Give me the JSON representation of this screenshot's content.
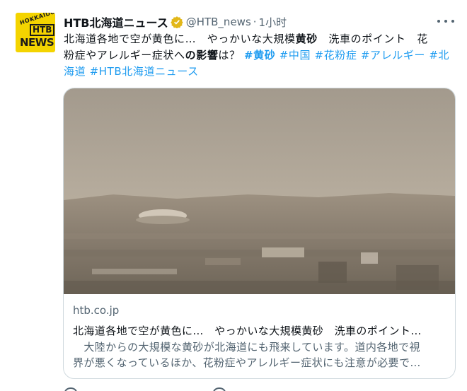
{
  "account": {
    "display_name": "HTB北海道ニュース",
    "handle": "@HTB_news",
    "separator": "·",
    "time": "1小时",
    "avatar": {
      "arc_text": "HOKKAIDO",
      "box_text": "HTB",
      "bottom_text": "NEWS",
      "bg_color": "#f4d400"
    }
  },
  "tweet": {
    "line1": "北海道各地で空が黄色に…　やっかいな大規模",
    "line1_bold": "黄砂",
    "line1_end": "　洗車のポイント　花",
    "line2_a": "粉症やアレルギー症状へ",
    "line2_bold_no": "の",
    "line2_bold": "影響",
    "line2_b": "は？ ",
    "hashtags": [
      "#黄砂",
      "#中国",
      "#花粉症",
      "#アレルギー",
      "#北",
      "海道",
      "#HTB北海道ニュース"
    ]
  },
  "card": {
    "domain": "htb.co.jp",
    "title": "北海道各地で空が黄色に…　やっかいな大規模黄砂　洗車のポイント…",
    "desc_line1": "　大陸からの大規模な黄砂が北海道にも飛来しています。道内各地で視",
    "desc_line2": "界が悪くなっているほか、花粉症やアレルギー症状にも注意が必要で…"
  },
  "colors": {
    "link": "#1d9bf0",
    "muted": "#536471",
    "verified": "#e2b719",
    "border": "#cfd9de"
  },
  "icons": {
    "verified": "verified-badge-icon",
    "more": "more-options-icon"
  }
}
